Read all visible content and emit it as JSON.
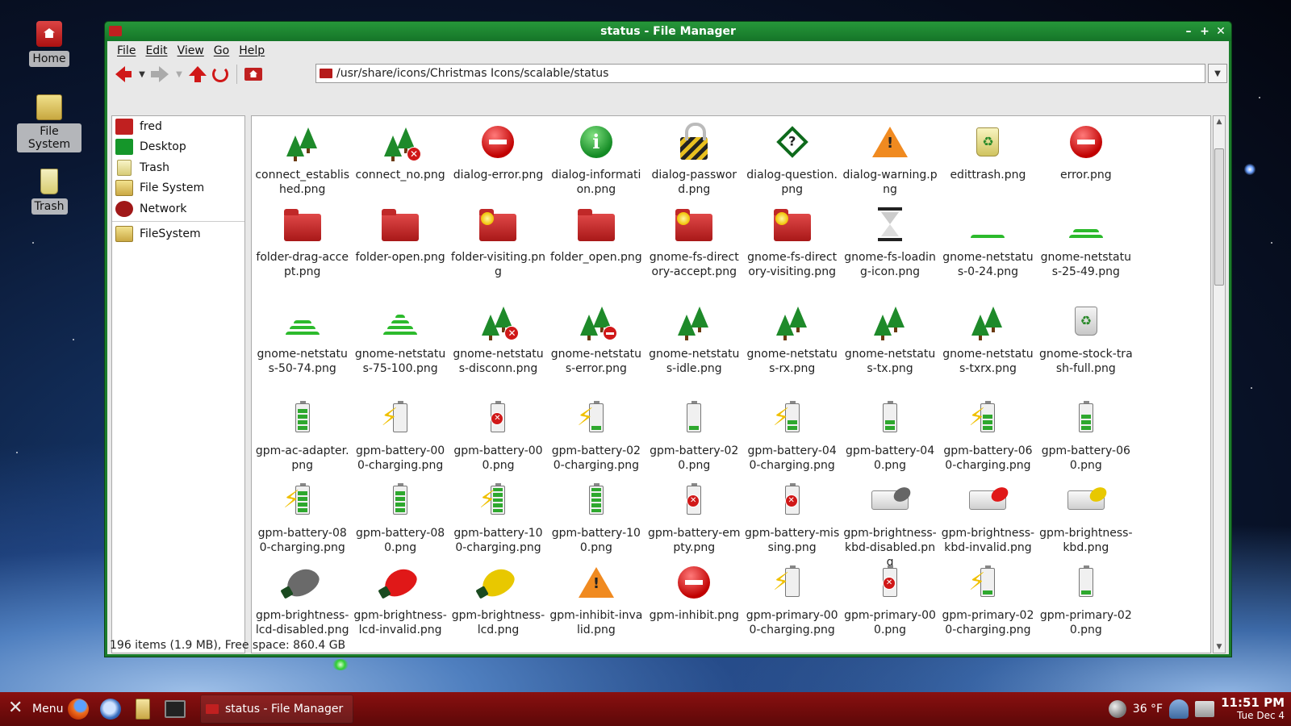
{
  "desktop": {
    "icons": [
      {
        "label": "Home"
      },
      {
        "label": "File System"
      },
      {
        "label": "Trash"
      }
    ]
  },
  "window": {
    "title": "status - File Manager",
    "controls": {
      "minimize": "–",
      "maximize": "+",
      "close": "✕"
    }
  },
  "menubar": {
    "file": "File",
    "edit": "Edit",
    "view": "View",
    "go": "Go",
    "help": "Help"
  },
  "toolbar": {
    "location": "/usr/share/icons/Christmas Icons/scalable/status"
  },
  "sidebar": {
    "items": [
      {
        "label": "fred",
        "icon": "home-folder-icon"
      },
      {
        "label": "Desktop",
        "icon": "desktop-icon"
      },
      {
        "label": "Trash",
        "icon": "trash-icon"
      },
      {
        "label": "File System",
        "icon": "drive-icon"
      },
      {
        "label": "Network",
        "icon": "network-icon"
      }
    ],
    "bookmarks": [
      {
        "label": "FileSystem",
        "icon": "drive-icon"
      }
    ]
  },
  "files": [
    "connect_established.png",
    "connect_no.png",
    "dialog-error.png",
    "dialog-information.png",
    "dialog-password.png",
    "dialog-question.png",
    "dialog-warning.png",
    "edittrash.png",
    "error.png",
    "folder-drag-accept.png",
    "folder-open.png",
    "folder-visiting.png",
    "folder_open.png",
    "gnome-fs-directory-accept.png",
    "gnome-fs-directory-visiting.png",
    "gnome-fs-loading-icon.png",
    "gnome-netstatus-0-24.png",
    "gnome-netstatus-25-49.png",
    "gnome-netstatus-50-74.png",
    "gnome-netstatus-75-100.png",
    "gnome-netstatus-disconn.png",
    "gnome-netstatus-error.png",
    "gnome-netstatus-idle.png",
    "gnome-netstatus-rx.png",
    "gnome-netstatus-tx.png",
    "gnome-netstatus-txrx.png",
    "gnome-stock-trash-full.png",
    "gpm-ac-adapter.png",
    "gpm-battery-000-charging.png",
    "gpm-battery-000.png",
    "gpm-battery-020-charging.png",
    "gpm-battery-020.png",
    "gpm-battery-040-charging.png",
    "gpm-battery-040.png",
    "gpm-battery-060-charging.png",
    "gpm-battery-060.png",
    "gpm-battery-080-charging.png",
    "gpm-battery-080.png",
    "gpm-battery-100-charging.png",
    "gpm-battery-100.png",
    "gpm-battery-empty.png",
    "gpm-battery-missing.png",
    "gpm-brightness-kbd-disabled.png",
    "gpm-brightness-kbd-invalid.png",
    "gpm-brightness-kbd.png",
    "gpm-brightness-lcd-disabled.png",
    "gpm-brightness-lcd-invalid.png",
    "gpm-brightness-lcd.png",
    "gpm-inhibit-invalid.png",
    "gpm-inhibit.png",
    "gpm-primary-000-charging.png",
    "gpm-primary-000.png",
    "gpm-primary-020-charging.png",
    "gpm-primary-020.png"
  ],
  "statusbar": {
    "text": "196 items (1.9 MB), Free space: 860.4 GB"
  },
  "taskbar": {
    "menu_label": "Menu",
    "task_label": "status - File Manager",
    "weather": "36 °F",
    "time": "11:51 PM",
    "date": "Tue Dec  4"
  },
  "colors": {
    "window_frame": "#1b7d2c",
    "taskbar": "#7a0c0c",
    "accent_red": "#c02020"
  }
}
